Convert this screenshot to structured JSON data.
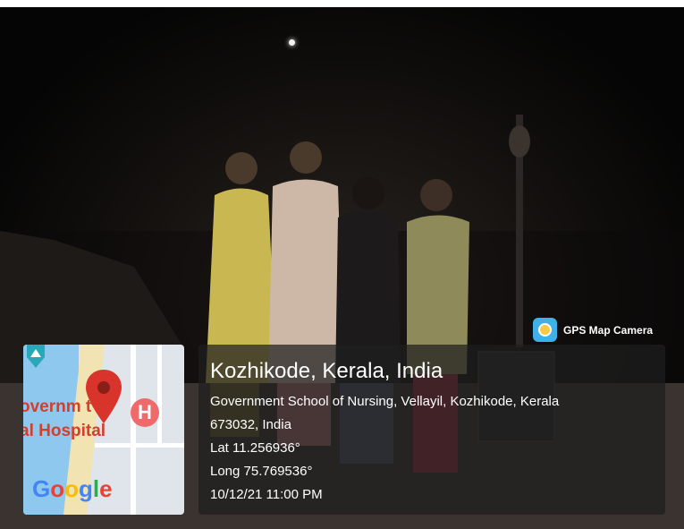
{
  "photo": {
    "badge_label": "GPS Map Camera",
    "badge_icon": "gps-map-camera-logo-icon"
  },
  "map": {
    "label_line1": "overnm  t",
    "label_line2": "al Hospital",
    "hospital_marker": "H",
    "brand": "Google",
    "pin_icon": "map-pin-icon",
    "colors": {
      "sea": "#8ec8ef",
      "label": "#d43e2a",
      "pin": "#d9342b"
    }
  },
  "info": {
    "title": "Kozhikode, Kerala, India",
    "address_line1": "Government School of Nursing, Vellayil, Kozhikode, Kerala",
    "address_line2": "673032, India",
    "latitude": "Lat 11.256936°",
    "longitude": "Long 75.769536°",
    "datetime": "10/12/21 11:00 PM"
  }
}
